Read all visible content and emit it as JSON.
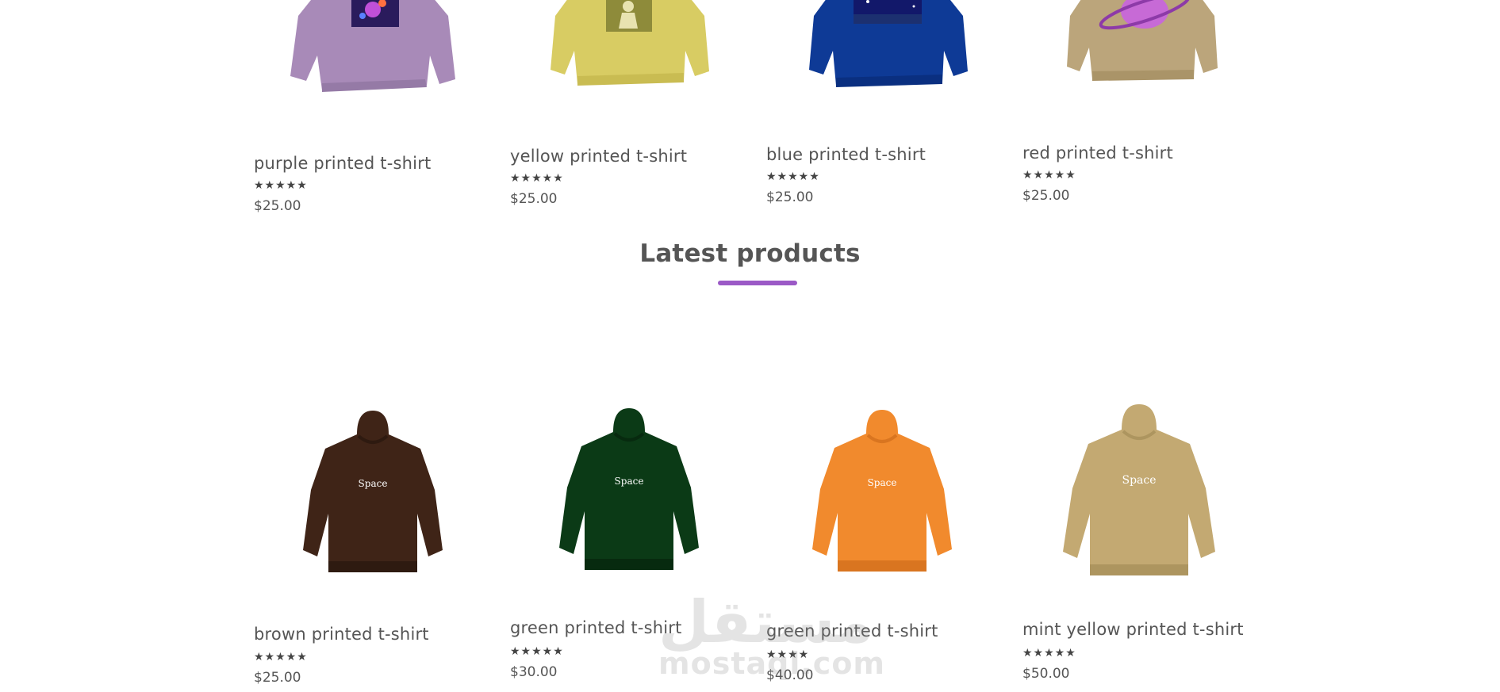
{
  "top_products": [
    {
      "name": "purple printed t-shirt",
      "rating": "★★★★★",
      "price": "$25.00",
      "color": "#a88ab8",
      "print": "galaxy"
    },
    {
      "name": "yellow printed t-shirt",
      "rating": "★★★★★",
      "price": "$25.00",
      "color": "#d8cc63",
      "print": "yellow-figure"
    },
    {
      "name": "blue printed t-shirt",
      "rating": "★★★★★",
      "price": "$25.00",
      "color": "#0e3a96",
      "print": "night-sky"
    },
    {
      "name": "red printed t-shirt",
      "rating": "★★★★★",
      "price": "$25.00",
      "color": "#bba57b",
      "print": "planet"
    }
  ],
  "latest": {
    "title": "Latest products",
    "accent": "#9b59c6",
    "products": [
      {
        "name": "brown printed t-shirt",
        "rating": "★★★★★",
        "price": "$25.00",
        "color": "#3f2417",
        "print_text": "Space"
      },
      {
        "name": "green printed t-shirt",
        "rating": "★★★★★",
        "price": "$30.00",
        "color": "#0b3a16",
        "print_text": "Space"
      },
      {
        "name": "green printed t-shirt",
        "rating": "★★★★",
        "price": "$40.00",
        "color": "#f18a2d",
        "print_text": "Space"
      },
      {
        "name": "mint yellow printed t-shirt",
        "rating": "★★★★★",
        "price": "$50.00",
        "color": "#c3a972",
        "print_text": "Space"
      }
    ]
  },
  "watermark": {
    "arabic": "مستقل",
    "latin": "mostaql.com"
  }
}
